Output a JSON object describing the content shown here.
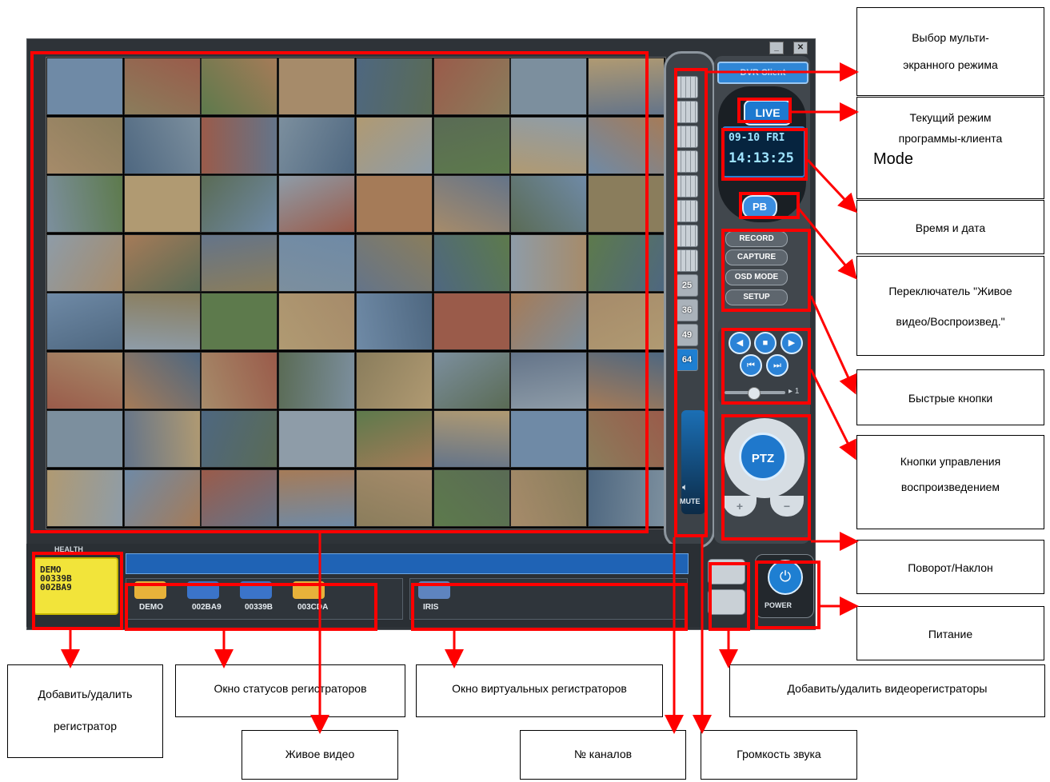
{
  "app": {
    "multiscreen_options": [
      "",
      "",
      "",
      "",
      "",
      "",
      "",
      "",
      "25",
      "36",
      "49",
      "64"
    ],
    "selected_multiscreen": "64",
    "top_button": "DVR Client",
    "mode_label": "LIVE",
    "date": "09-10 FRI",
    "time": "14:13:25",
    "pb_label": "PB",
    "record_label": "RECORD",
    "capture_label": "CAPTURE",
    "osd_label": "OSD MODE",
    "setup_label": "SETUP",
    "speed_label": "1",
    "ptz_label": "PTZ",
    "zoom_in": "+",
    "zoom_out": "−",
    "mute_label": "MUTE",
    "power_label": "POWER",
    "health_label": "HEALTH",
    "dvr_list": [
      "DEMO",
      "00339B",
      "002BA9"
    ],
    "devices": [
      {
        "label": "DEMO",
        "color": "#e7b23a"
      },
      {
        "label": "002BA9",
        "color": "#3b74c9"
      },
      {
        "label": "00339B",
        "color": "#3b74c9"
      },
      {
        "label": "003CDA",
        "color": "#e7b23a"
      }
    ],
    "virtual_devices": [
      {
        "label": "IRIS",
        "color": "#5e84bf"
      }
    ]
  },
  "callouts": {
    "multiscreen": [
      "Выбор мульти-",
      "экранного режима"
    ],
    "current_mode": [
      "Текущий режим",
      "программы-клиента",
      "Mode"
    ],
    "datetime": [
      "Время и дата"
    ],
    "live_pb_switch": [
      "Переключатель \"Живое",
      "видео/Воспроизвед.\""
    ],
    "quick_buttons": [
      "Быстрые кнопки"
    ],
    "playback_controls": [
      "Кнопки управления",
      "воспроизведением"
    ],
    "pan_tilt": [
      "Поворот/Наклон"
    ],
    "power": [
      "Питание"
    ],
    "add_remove_dvr": [
      "Добавить/удалить",
      "регистратор"
    ],
    "dvr_status": [
      "Окно статусов регистраторов"
    ],
    "virtual_dvr": [
      "Окно виртуальных регистраторов"
    ],
    "add_remove_recorders": [
      "Добавить/удалить видеорегистраторы"
    ],
    "live_video": [
      "Живое видео"
    ],
    "channel_no": [
      "№ каналов"
    ],
    "volume": [
      "Громкость звука"
    ]
  },
  "colors": {
    "highlight": "#ff0000",
    "accent_blue": "#1e7fd2",
    "yellow_panel": "#f2e43a"
  }
}
